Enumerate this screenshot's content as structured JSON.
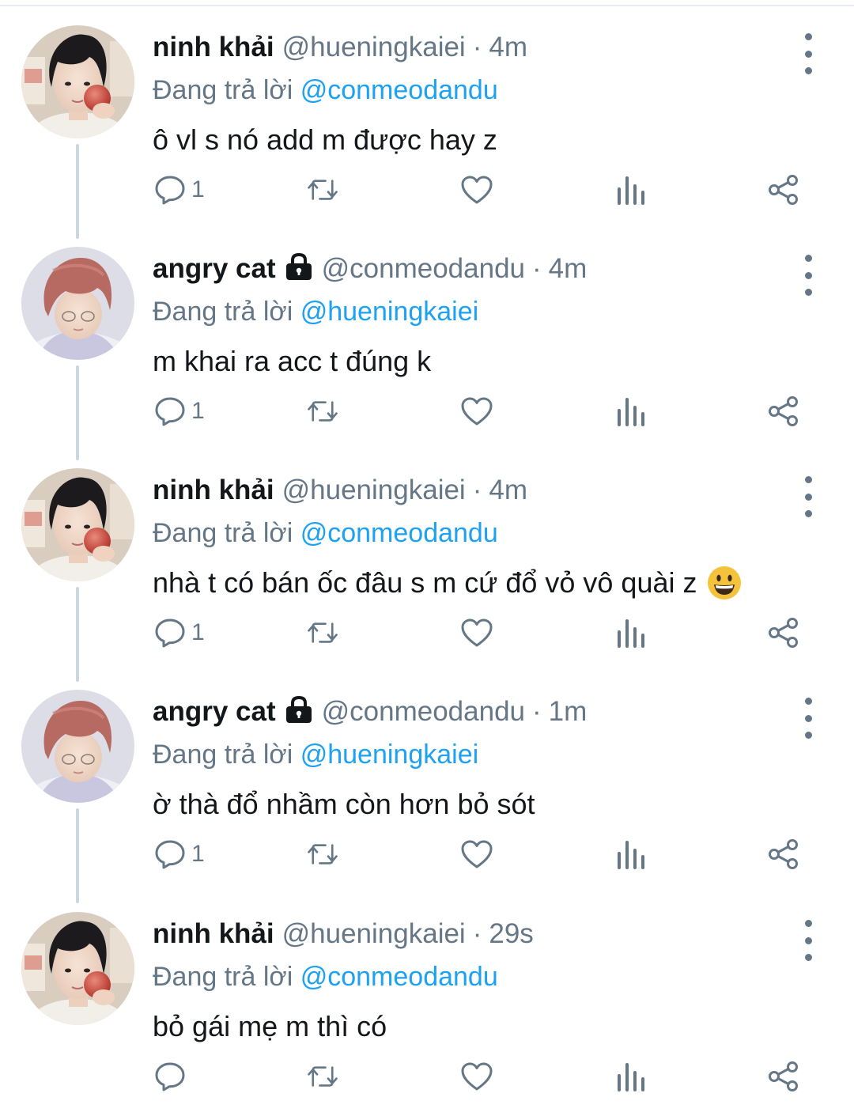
{
  "reply_prefix": "Đang trả lời",
  "tweets": [
    {
      "name": "ninh khải",
      "handle": "@hueningkaiei",
      "separator": "·",
      "time": "4m",
      "reply_to": "@conmeodandu",
      "text": "ô vl s nó add m được hay z",
      "reply_count": "1",
      "locked": false,
      "avatar": "avatar-photo-dark-hair-apple"
    },
    {
      "name": "angry cat",
      "handle": "@conmeodandu",
      "separator": "·",
      "time": "4m",
      "reply_to": "@hueningkaiei",
      "text": "m khai ra acc t đúng k",
      "reply_count": "1",
      "locked": true,
      "avatar": "avatar-photo-pink-hair"
    },
    {
      "name": "ninh khải",
      "handle": "@hueningkaiei",
      "separator": "·",
      "time": "4m",
      "reply_to": "@conmeodandu",
      "text": "nhà t có bán ốc đâu s m cứ đổ vỏ vô quài z",
      "reply_count": "1",
      "locked": false,
      "emoji": "grinning-face",
      "avatar": "avatar-photo-dark-hair-apple"
    },
    {
      "name": "angry cat",
      "handle": "@conmeodandu",
      "separator": "·",
      "time": "1m",
      "reply_to": "@hueningkaiei",
      "text": "ờ thà đổ nhầm còn hơn bỏ sót",
      "reply_count": "1",
      "locked": true,
      "avatar": "avatar-photo-pink-hair"
    },
    {
      "name": "ninh khải",
      "handle": "@hueningkaiei",
      "separator": "·",
      "time": "29s",
      "reply_to": "@conmeodandu",
      "text": "bỏ gái mẹ m thì có",
      "reply_count": "",
      "locked": false,
      "avatar": "avatar-photo-dark-hair-apple"
    }
  ],
  "icons": {
    "reply": "reply-bubble-icon",
    "retweet": "retweet-icon",
    "like": "heart-icon",
    "analytics": "analytics-bars-icon",
    "share": "share-icon",
    "more": "vertical-dots-icon",
    "lock": "lock-icon"
  },
  "colors": {
    "text": "#14171a",
    "secondary": "#657786",
    "link": "#1da1f2",
    "thread_line": "#ccd6dd"
  }
}
